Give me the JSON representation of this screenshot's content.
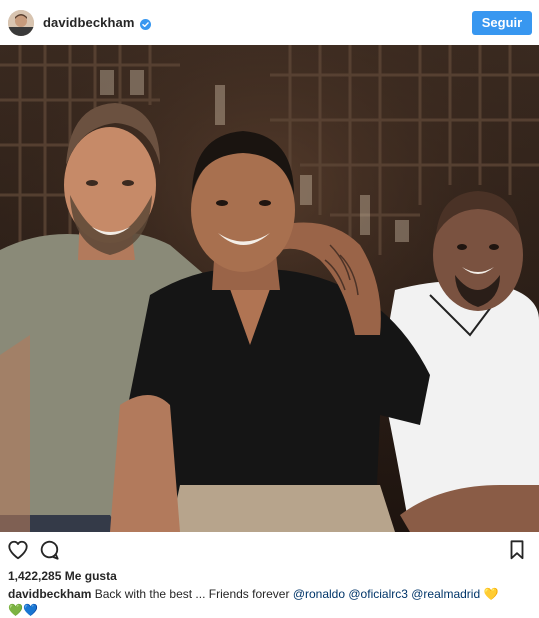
{
  "header": {
    "username": "davidbeckham",
    "follow_label": "Seguir"
  },
  "post": {
    "likes_count": "1,422,285",
    "likes_suffix": "Me gusta"
  },
  "caption": {
    "username": "davidbeckham",
    "text": "Back with the best ... Friends forever",
    "mentions": [
      "@ronaldo",
      "@oficialrc3",
      "@realmadrid"
    ],
    "emojis": [
      "💛",
      "💚",
      "💙"
    ]
  },
  "colors": {
    "accent": "#3897f0",
    "mention": "#003569",
    "verified": "#3897f0"
  },
  "icons": {
    "like": "heart-outline-icon",
    "comment": "comment-bubble-icon",
    "save": "bookmark-icon",
    "verified": "verified-badge-icon"
  }
}
